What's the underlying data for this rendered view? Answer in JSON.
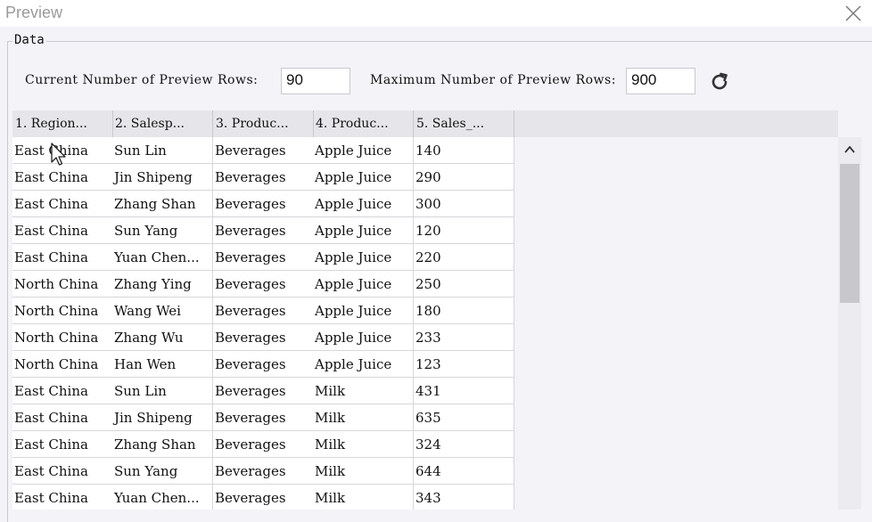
{
  "window": {
    "title": "Preview"
  },
  "group": {
    "label": "Data"
  },
  "controls": {
    "current_rows_label": "Current Number of Preview Rows:",
    "current_rows_value": "90",
    "max_rows_label": "Maximum Number of Preview Rows:",
    "max_rows_value": "900",
    "refresh_icon": "refresh-icon"
  },
  "table": {
    "columns": [
      "1. Region...",
      "2. Salesp...",
      "3. Produc...",
      "4. Produc...",
      "5. Sales_..."
    ],
    "rows": [
      [
        "East China",
        "Sun Lin",
        "Beverages",
        "Apple Juice",
        "140"
      ],
      [
        "East China",
        "Jin Shipeng",
        "Beverages",
        "Apple Juice",
        "290"
      ],
      [
        "East China",
        "Zhang Shan",
        "Beverages",
        "Apple Juice",
        "300"
      ],
      [
        "East China",
        "Sun Yang",
        "Beverages",
        "Apple Juice",
        "120"
      ],
      [
        "East China",
        "Yuan Chen...",
        "Beverages",
        "Apple Juice",
        "220"
      ],
      [
        "North China",
        "Zhang Ying",
        "Beverages",
        "Apple Juice",
        "250"
      ],
      [
        "North China",
        "Wang Wei",
        "Beverages",
        "Apple Juice",
        "180"
      ],
      [
        "North China",
        "Zhang Wu",
        "Beverages",
        "Apple Juice",
        "233"
      ],
      [
        "North China",
        "Han Wen",
        "Beverages",
        "Apple Juice",
        "123"
      ],
      [
        "East China",
        "Sun Lin",
        "Beverages",
        "Milk",
        "431"
      ],
      [
        "East China",
        "Jin Shipeng",
        "Beverages",
        "Milk",
        "635"
      ],
      [
        "East China",
        "Zhang Shan",
        "Beverages",
        "Milk",
        "324"
      ],
      [
        "East China",
        "Sun Yang",
        "Beverages",
        "Milk",
        "644"
      ],
      [
        "East China",
        "Yuan Chen...",
        "Beverages",
        "Milk",
        "343"
      ]
    ]
  },
  "colors": {
    "background": "#f3f3f8",
    "header": "#e6e6ea",
    "cell": "#ffffff",
    "scroll_thumb": "#c8c8cc"
  }
}
